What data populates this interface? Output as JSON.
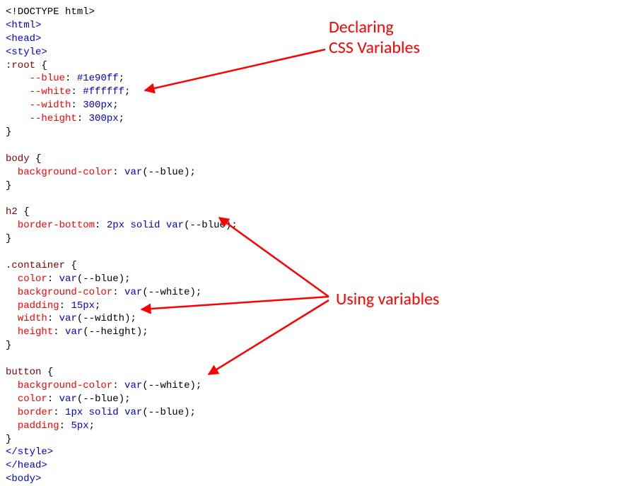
{
  "annotations": {
    "declaring": "Declaring\nCSS Variables",
    "using": "Using variables"
  },
  "code": {
    "l1": "<!DOCTYPE html>",
    "l2": "<html>",
    "l3": "<head>",
    "l4": "<style>",
    "l5_sel": ":root",
    "l5_brace": " {",
    "l6_prop": "--blue",
    "l6_val": "#1e90ff",
    "l7_prop": "--white",
    "l7_val": "#ffffff",
    "l8_prop": "--width",
    "l8_val": "300px",
    "l9_prop": "--height",
    "l9_val": "300px",
    "l10_brace": "}",
    "l12_sel": "body",
    "l13_prop": "background-color",
    "l13_var": "--blue",
    "l16_sel": "h2",
    "l17_prop": "border-bottom",
    "l17_val": "2px solid",
    "l17_var": "--blue",
    "l20_sel": ".container",
    "l21_prop": "color",
    "l21_var": "--blue",
    "l22_prop": "background-color",
    "l22_var": "--white",
    "l23_prop": "padding",
    "l23_val": "15px",
    "l24_prop": "width",
    "l24_var": "--width",
    "l25_prop": "height",
    "l25_var": "--height",
    "l28_sel": "button",
    "l29_prop": "background-color",
    "l29_var": "--white",
    "l30_prop": "color",
    "l30_var": "--blue",
    "l31_prop": "border",
    "l31_val": "1px solid",
    "l31_var": "--blue",
    "l32_prop": "padding",
    "l32_val": "5px",
    "l34": "</style>",
    "l35": "</head>",
    "l36": "<body>",
    "var_open": "var",
    "paren_open": "(",
    "paren_close": ")",
    "colon": ": ",
    "semi": ";",
    "indent": "  ",
    "indent2": "    ",
    "brace_open": " {",
    "brace_close": "}"
  }
}
